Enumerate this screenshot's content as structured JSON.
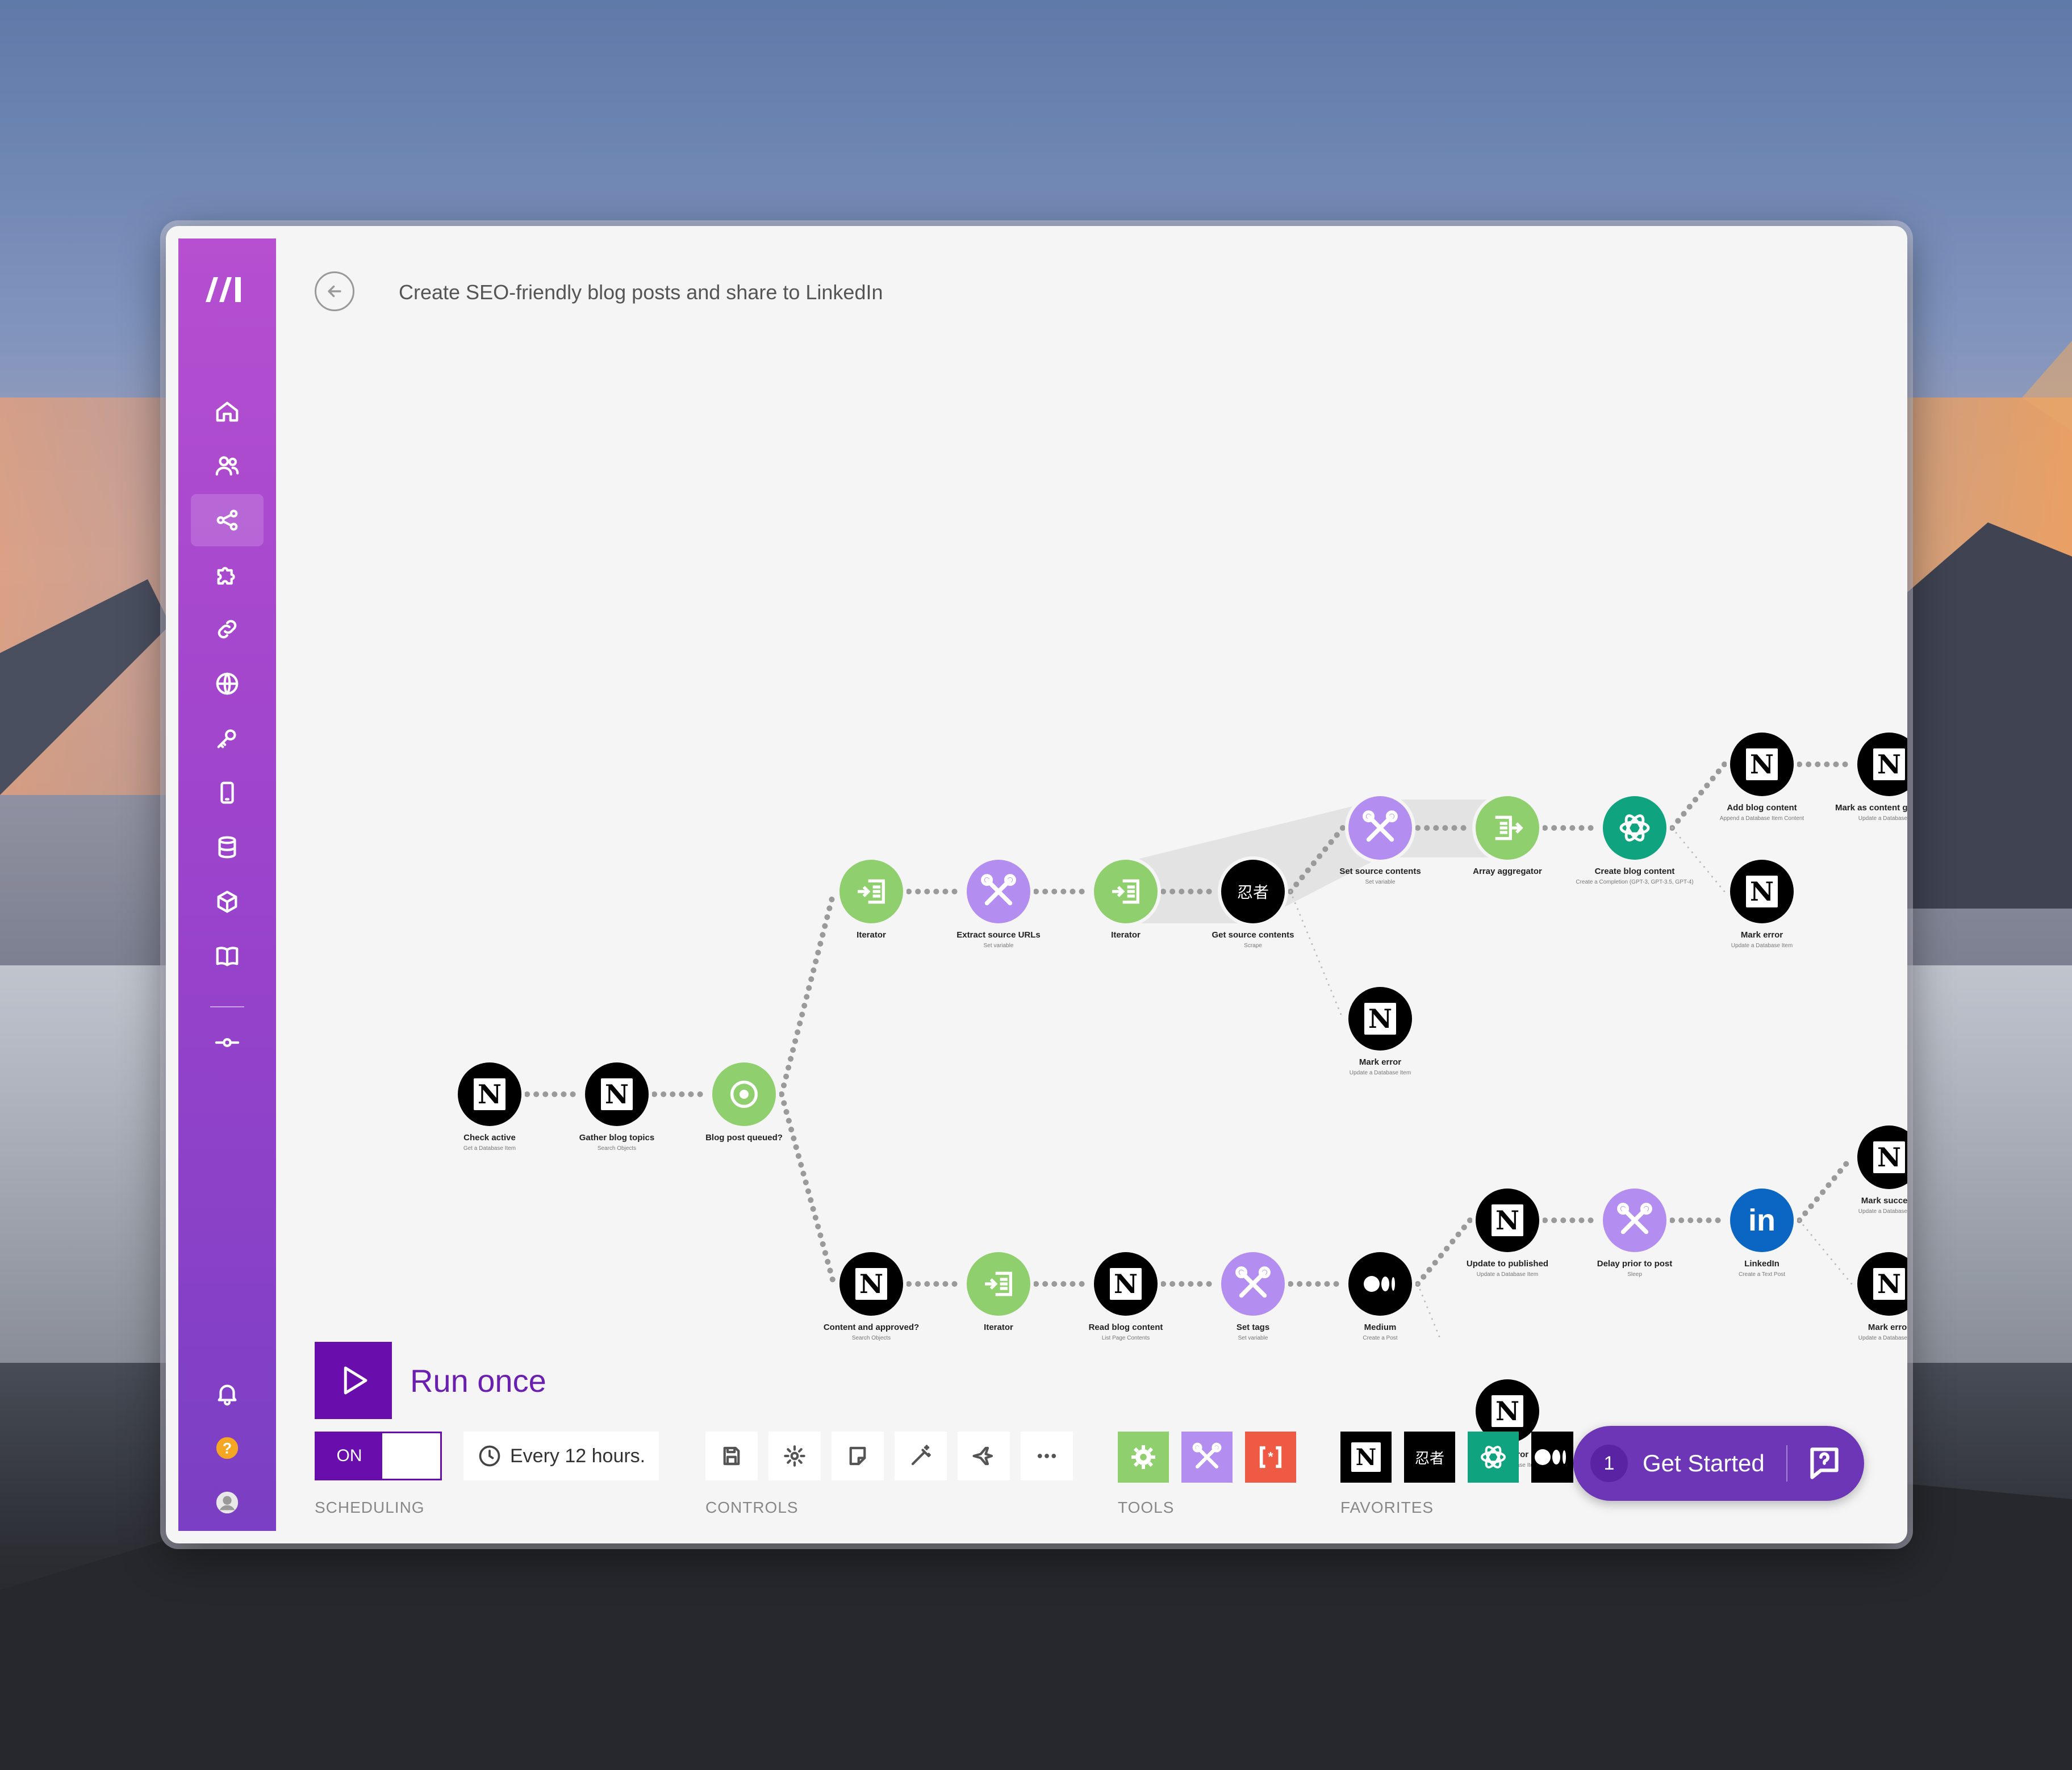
{
  "app": {
    "title": "Create SEO-friendly blog posts and share to LinkedIn"
  },
  "sidebar": {
    "items": [
      {
        "name": "home-icon"
      },
      {
        "name": "team-icon"
      },
      {
        "name": "scenarios-icon",
        "active": true
      },
      {
        "name": "apps-icon"
      },
      {
        "name": "connections-icon"
      },
      {
        "name": "webhooks-icon"
      },
      {
        "name": "keys-icon"
      },
      {
        "name": "devices-icon"
      },
      {
        "name": "datastores-icon"
      },
      {
        "name": "datastructures-icon"
      },
      {
        "name": "docs-icon"
      },
      {
        "name": "flow-icon"
      }
    ],
    "bottom": [
      "notifications-icon",
      "help-icon",
      "profile-icon"
    ]
  },
  "modules": [
    {
      "id": "check-active",
      "label": "Check active",
      "sub": "Get a Database Item",
      "app": "notion"
    },
    {
      "id": "gather-blog-topics",
      "label": "Gather blog topics",
      "sub": "Search Objects",
      "app": "notion"
    },
    {
      "id": "blog-post-queued",
      "label": "Blog post queued?",
      "sub": "",
      "app": "router"
    },
    {
      "id": "iterator-1",
      "label": "Iterator",
      "sub": "",
      "app": "iterator"
    },
    {
      "id": "extract-source-urls",
      "label": "Extract source URLs",
      "sub": "Set variable",
      "app": "tools"
    },
    {
      "id": "iterator-2",
      "label": "Iterator",
      "sub": "",
      "app": "iterator"
    },
    {
      "id": "get-source-contents",
      "label": "Get source contents",
      "sub": "Scrape",
      "app": "ninja"
    },
    {
      "id": "set-source-contents",
      "label": "Set source contents",
      "sub": "Set variable",
      "app": "tools"
    },
    {
      "id": "array-aggregator",
      "label": "Array aggregator",
      "sub": "",
      "app": "aggregator"
    },
    {
      "id": "create-blog-content",
      "label": "Create blog content",
      "sub": "Create a Completion (GPT-3, GPT-3.5, GPT-4)",
      "app": "openai"
    },
    {
      "id": "add-blog-content",
      "label": "Add blog content",
      "sub": "Append a Database Item Content",
      "app": "notion"
    },
    {
      "id": "mark-as-content-generated",
      "label": "Mark as content generated",
      "sub": "Update a Database Item",
      "app": "notion"
    },
    {
      "id": "mark-error-1",
      "label": "Mark error",
      "sub": "Update a Database Item",
      "app": "notion"
    },
    {
      "id": "mark-error-2",
      "label": "Mark error",
      "sub": "Update a Database Item",
      "app": "notion"
    },
    {
      "id": "content-and-approved",
      "label": "Content and approved?",
      "sub": "Search Objects",
      "app": "notion"
    },
    {
      "id": "iterator-3",
      "label": "Iterator",
      "sub": "",
      "app": "iterator"
    },
    {
      "id": "read-blog-content",
      "label": "Read blog content",
      "sub": "List Page Contents",
      "app": "notion"
    },
    {
      "id": "set-tags",
      "label": "Set tags",
      "sub": "Set variable",
      "app": "tools"
    },
    {
      "id": "medium",
      "label": "Medium",
      "sub": "Create a Post",
      "app": "medium"
    },
    {
      "id": "update-to-published",
      "label": "Update to published",
      "sub": "Update a Database Item",
      "app": "notion"
    },
    {
      "id": "delay-prior-to-post",
      "label": "Delay prior to post",
      "sub": "Sleep",
      "app": "tools"
    },
    {
      "id": "linkedin",
      "label": "LinkedIn",
      "sub": "Create a Text Post",
      "app": "linkedin"
    },
    {
      "id": "mark-success",
      "label": "Mark success",
      "sub": "Update a Database Item",
      "app": "notion"
    },
    {
      "id": "mark-error-3",
      "label": "Mark error",
      "sub": "Update a Database Item",
      "app": "notion"
    },
    {
      "id": "mark-error-4",
      "label": "Mark error",
      "sub": "Update a Database Item",
      "app": "notion"
    }
  ],
  "controls": {
    "run_label": "Run once",
    "toggle_on": "ON",
    "schedule": "Every 12 hours.",
    "scheduling_label": "SCHEDULING",
    "controls_label": "CONTROLS",
    "tools_label": "TOOLS",
    "favorites_label": "FAVORITES"
  },
  "get_started": {
    "count": "1",
    "label": "Get Started"
  },
  "colors": {
    "brand": "#6a0dad",
    "sidebar_top": "#b64fd0",
    "sidebar_bottom": "#7a3fc4",
    "iterator_green": "#8fcf6e",
    "tools_purple": "#b38ef0",
    "openai_teal": "#10a37f",
    "linkedin_blue": "#0a66c2",
    "help_orange": "#f5a623"
  }
}
